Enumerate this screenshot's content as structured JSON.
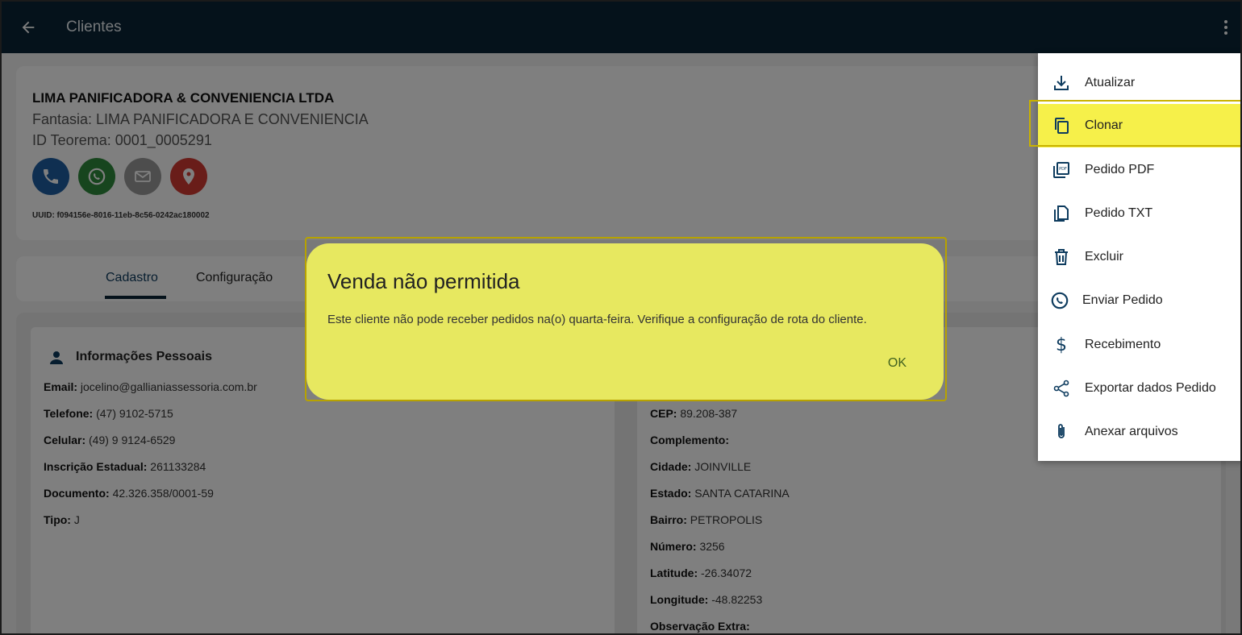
{
  "appbar": {
    "title": "Clientes",
    "back_icon": "arrow-left-icon",
    "more_icon": "more-vertical-icon"
  },
  "client": {
    "name": "LIMA PANIFICADORA & CONVENIENCIA LTDA",
    "fantasia": "Fantasia: LIMA PANIFICADORA E CONVENIENCIA",
    "id": "ID Teorema: 0001_0005291",
    "uuid": "UUID: f094156e-8016-11eb-8c56-0242ac180002",
    "actions": [
      {
        "icon": "phone-icon",
        "color": "#1f5fa3"
      },
      {
        "icon": "whatsapp-icon",
        "color": "#2f8a3c"
      },
      {
        "icon": "email-icon",
        "color": "#9a9a9a"
      },
      {
        "icon": "location-icon",
        "color": "#d23a32"
      }
    ]
  },
  "tabs": [
    "Cadastro",
    "Configuração"
  ],
  "personal": {
    "title": "Informações Pessoais",
    "rows": [
      {
        "label": "Email:",
        "value": "jocelino@gallianiassessoria.com.br"
      },
      {
        "label": "Telefone:",
        "value": "(47) 9102-5715"
      },
      {
        "label": "Celular:",
        "value": "(49) 9 9124-6529"
      },
      {
        "label": "Inscrição Estadual:",
        "value": "261133284"
      },
      {
        "label": "Documento:",
        "value": "42.326.358/0001-59"
      },
      {
        "label": "Tipo:",
        "value": "J"
      }
    ]
  },
  "address": {
    "rows": [
      {
        "label": "CEP:",
        "value": "89.208-387"
      },
      {
        "label": "Complemento:",
        "value": ""
      },
      {
        "label": "Cidade:",
        "value": "JOINVILLE"
      },
      {
        "label": "Estado:",
        "value": "SANTA CATARINA"
      },
      {
        "label": "Bairro:",
        "value": "PETROPOLIS"
      },
      {
        "label": "Número:",
        "value": "3256"
      },
      {
        "label": "Latitude:",
        "value": "-26.34072"
      },
      {
        "label": "Longitude:",
        "value": "-48.82253"
      },
      {
        "label": "Observação Extra:",
        "value": ""
      }
    ]
  },
  "dialog": {
    "title": "Venda não permitida",
    "message": "Este cliente não pode receber pedidos na(o) quarta-feira. Verifique a configuração de rota do cliente.",
    "ok": "OK"
  },
  "menu": {
    "items": [
      {
        "label": "Atualizar",
        "icon": "download-icon"
      },
      {
        "label": "Clonar",
        "icon": "copy-icon"
      },
      {
        "label": "Pedido PDF",
        "icon": "pdf-icon"
      },
      {
        "label": "Pedido TXT",
        "icon": "file-icon"
      },
      {
        "label": "Excluir",
        "icon": "trash-icon"
      },
      {
        "label": "Enviar Pedido",
        "icon": "whatsapp-icon"
      },
      {
        "label": "Recebimento",
        "icon": "dollar-icon"
      },
      {
        "label": "Exportar dados Pedido",
        "icon": "share-icon"
      },
      {
        "label": "Anexar arquivos",
        "icon": "paperclip-icon"
      }
    ],
    "highlighted": "Clonar"
  },
  "colors": {
    "appbar": "#0b2437",
    "dialog": "#e7e860",
    "menu_highlight": "#f6f04a"
  }
}
